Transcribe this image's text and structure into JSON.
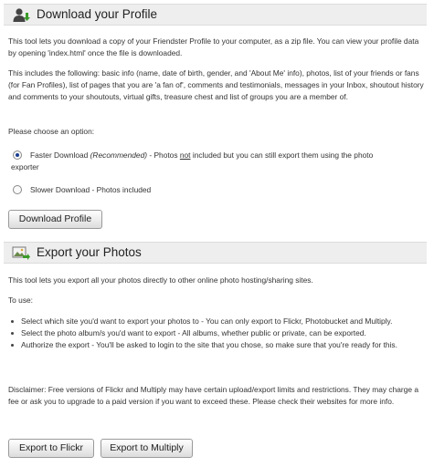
{
  "download_section": {
    "title": "Download your Profile",
    "icon": "user-download-icon",
    "intro": "This tool lets you download a copy of your Friendster Profile to your computer, as a zip file. You can view your profile data by opening 'index.html' once the file is downloaded.",
    "includes": "This includes the following: basic info (name, date of birth, gender, and 'About Me' info), photos, list of your friends or fans (for Fan Profiles), list of pages that you are 'a fan of', comments and testimonials, messages in your Inbox, shoutout history and comments to your shoutouts, virtual gifts, treasure chest and list of groups you are a member of.",
    "prompt": "Please choose an option:",
    "options": [
      {
        "label": "Faster Download",
        "note": "(Recommended)",
        "desc_before": " - Photos ",
        "desc_underline": "not",
        "desc_after": " included but you can still export them using the photo exporter",
        "selected": true
      },
      {
        "label": "Slower Download - Photos included",
        "selected": false
      }
    ],
    "button": "Download Profile"
  },
  "export_section": {
    "title": "Export your Photos",
    "icon": "photo-export-icon",
    "intro": "This tool lets you export all your photos directly to other online photo hosting/sharing sites.",
    "to_use": "To use:",
    "steps": [
      "Select which site you'd want to export your photos to - You can only export to Flickr, Photobucket and Multiply.",
      "Select the photo album/s you'd want to export - All albums, whether public or private, can be exported.",
      "Authorize the export - You'll be asked to login to the site that you chose, so make sure that you're ready for this."
    ],
    "disclaimer": "Disclaimer: Free versions of Flickr and Multiply may have certain upload/export limits and restrictions. They may charge a fee or ask you to upgrade to a paid version if you want to exceed these. Please check their websites for more info.",
    "buttons": {
      "flickr": "Export to Flickr",
      "multiply": "Export to Multiply"
    }
  }
}
